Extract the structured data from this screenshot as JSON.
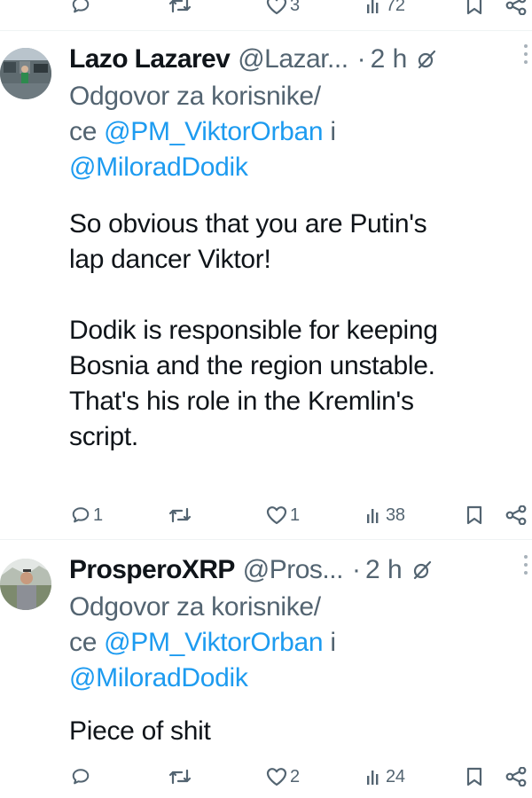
{
  "top_actions": {
    "like_count": "3",
    "views_count": "72"
  },
  "tweets": [
    {
      "display_name": "Lazo Lazarev",
      "handle": "@Lazar...",
      "separator": "·",
      "time": "2 h",
      "reply_prefix_1": "Odgovor za korisnike/",
      "reply_prefix_2": "ce ",
      "mention_1": "@PM_ViktorOrban",
      "reply_and": " i",
      "mention_2": "@MiloradDodik",
      "text": "So obvious that you are Putin's\nlap dancer Viktor!\n\nDodik is responsible for keeping\nBosnia and the region unstable.\nThat's his role in the Kremlin's\nscript.",
      "reply_count": "1",
      "retweet_count": "",
      "like_count": "1",
      "views_count": "38"
    },
    {
      "display_name": "ProsperoXRP",
      "handle": "@Pros...",
      "separator": "·",
      "time": "2 h",
      "reply_prefix_1": "Odgovor za korisnike/",
      "reply_prefix_2": "ce ",
      "mention_1": "@PM_ViktorOrban",
      "reply_and": " i",
      "mention_2": "@MiloradDodik",
      "text": "Piece of shit",
      "reply_count": "",
      "retweet_count": "",
      "like_count": "2",
      "views_count": "24"
    }
  ],
  "colors": {
    "text_primary": "#0f1419",
    "text_secondary": "#536471",
    "link": "#1d9bf0"
  }
}
